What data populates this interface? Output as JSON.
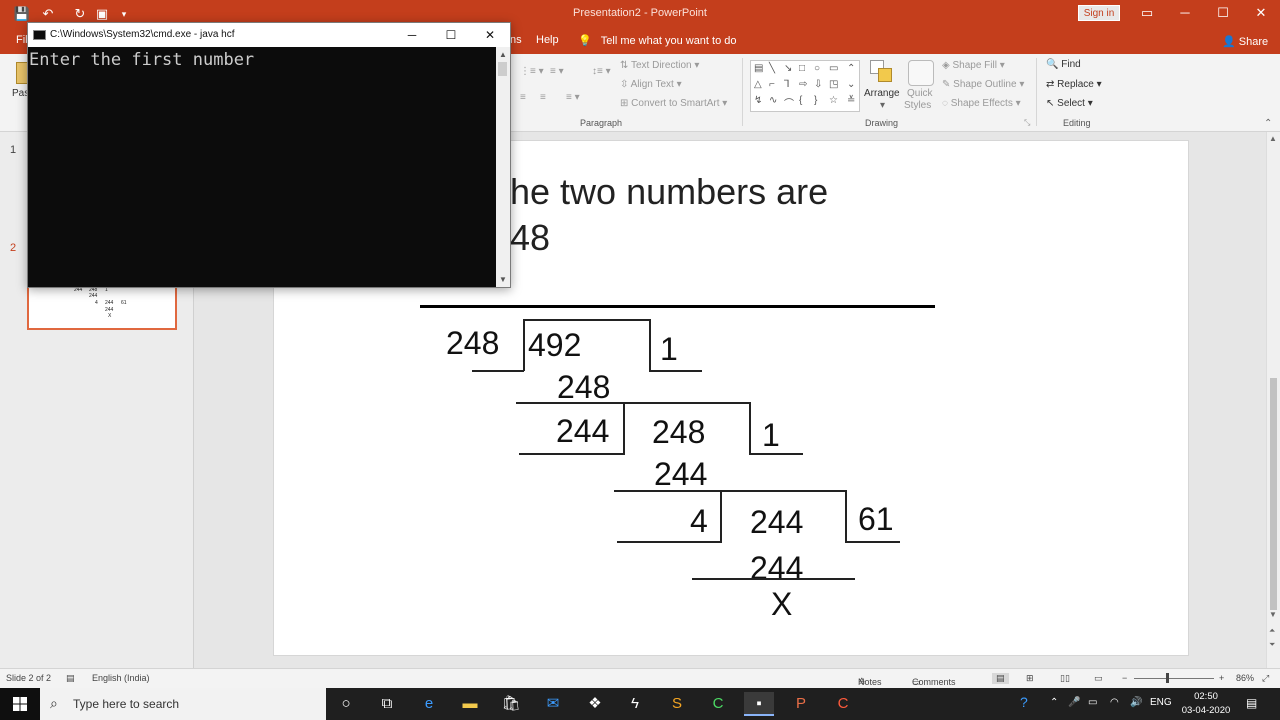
{
  "app": {
    "window_title": "Presentation2  -  PowerPoint",
    "signin_label": "Sign in",
    "share_label": "Share",
    "tell_me": "Tell me what you want to do",
    "tabs": {
      "file": "Fil",
      "home_partial": "ns",
      "help": "Help"
    }
  },
  "ribbon": {
    "paste_partial": "Pas",
    "paragraph": {
      "label": "Paragraph",
      "text_direction": "Text Direction",
      "align_text": "Align Text",
      "convert_smartart": "Convert to SmartArt"
    },
    "drawing": {
      "label": "Drawing",
      "arrange": "Arrange",
      "quick_styles_1": "Quick",
      "quick_styles_2": "Styles",
      "shape_fill": "Shape Fill",
      "shape_outline": "Shape Outline",
      "shape_effects": "Shape Effects"
    },
    "editing": {
      "label": "Editing",
      "find": "Find",
      "replace": "Replace",
      "select": "Select"
    }
  },
  "thumbnails": {
    "slide_numbers": [
      "1",
      "2"
    ],
    "thumb2_text": [
      "244",
      "248",
      "1",
      "244",
      "4",
      "244",
      "61",
      "244",
      "X"
    ]
  },
  "slide": {
    "title_line1": "he two numbers are",
    "title_line2": "48",
    "division": {
      "d1_divisor": "248",
      "d1_dividend": "492",
      "d1_quotient": "1",
      "d1_product": "248",
      "d2_divisor": "244",
      "d2_dividend": "248",
      "d2_quotient": "1",
      "d2_product": "244",
      "d3_divisor": "4",
      "d3_dividend": "244",
      "d3_quotient": "61",
      "d3_product": "244",
      "remainder": "X"
    }
  },
  "status": {
    "slide_of": "Slide 2 of 2",
    "language": "English (India)",
    "notes": "Notes",
    "comments": "Comments",
    "zoom": "86%",
    "zoom_minus": "−",
    "zoom_plus": "+"
  },
  "cmd": {
    "title": "C:\\Windows\\System32\\cmd.exe - java  hcf",
    "output": "Enter the first number",
    "minimize": "─",
    "maximize": "☐",
    "close": "✕"
  },
  "taskbar": {
    "search_placeholder": "Type here to search",
    "lang": "ENG",
    "time": "02:50",
    "date": "03-04-2020"
  }
}
